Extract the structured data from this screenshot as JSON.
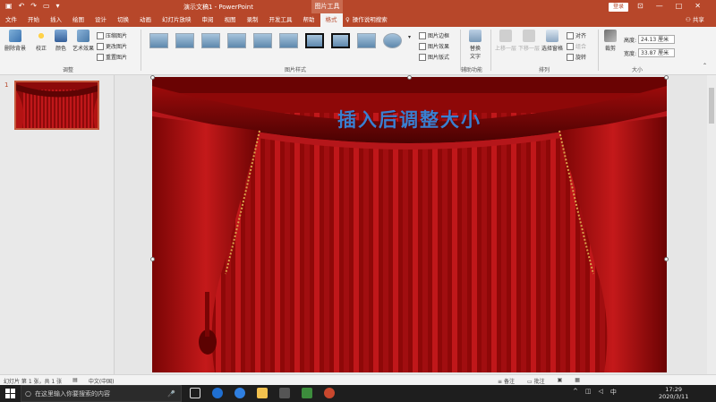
{
  "titlebar": {
    "title": "演示文稿1 - PowerPoint",
    "context_tools": "图片工具",
    "login": "登录",
    "minimize": "—",
    "restore": "□",
    "close": "✕"
  },
  "tabs": [
    "文件",
    "开始",
    "插入",
    "绘图",
    "设计",
    "切换",
    "动画",
    "幻灯片放映",
    "审阅",
    "视图",
    "录制",
    "开发工具",
    "帮助",
    "格式"
  ],
  "active_tab": "格式",
  "tell_me": "操作说明搜索",
  "share": "共享",
  "ribbon": {
    "adjust": {
      "remove_bg": "删除背景",
      "corrections": "校正",
      "color": "颜色",
      "artistic": "艺术效果",
      "compress": "压缩图片",
      "change": "更改图片",
      "reset": "重置图片",
      "label": "调整"
    },
    "styles": {
      "border": "图片边框",
      "effects": "图片效果",
      "layout": "图片版式",
      "label": "图片样式"
    },
    "accessibility": {
      "alt_text_1": "替换",
      "alt_text_2": "文字",
      "label": "辅助功能"
    },
    "arrange": {
      "bring_forward": "上移一层",
      "send_backward": "下移一层",
      "selection_pane": "选择窗格",
      "align": "对齐",
      "group": "组合",
      "rotate": "旋转",
      "label": "排列"
    },
    "size": {
      "crop": "裁剪",
      "height_label": "高度:",
      "height_value": "24.13 厘米",
      "width_label": "宽度:",
      "width_value": "33.87 厘米",
      "label": "大小"
    }
  },
  "slide_panel": {
    "slide_number": "1"
  },
  "slide": {
    "title": "插入后调整大小"
  },
  "statusbar": {
    "slide_info": "幻灯片 第 1 张，共 1 张",
    "language": "中文(中国)",
    "notes": "备注",
    "comments": "批注"
  },
  "taskbar": {
    "search_placeholder": "在这里输入你要搜索的内容",
    "input_method": "中",
    "time": "17:29",
    "date": "2020/3/11"
  },
  "colors": {
    "accent": "#b7472a",
    "slide_title": "#3a7fd0"
  }
}
